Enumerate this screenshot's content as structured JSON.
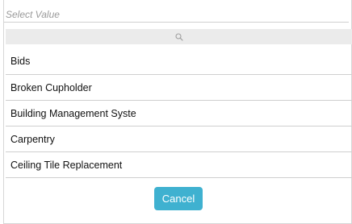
{
  "select": {
    "placeholder": "Select Value"
  },
  "search": {
    "icon": "search-icon"
  },
  "options": [
    {
      "label": "Bids"
    },
    {
      "label": "Broken Cupholder"
    },
    {
      "label": "Building Management Syste"
    },
    {
      "label": "Carpentry"
    },
    {
      "label": "Ceiling Tile Replacement"
    }
  ],
  "actions": {
    "cancel_label": "Cancel"
  },
  "colors": {
    "accent": "#3fb1d0",
    "search_bar_bg": "#ebebeb",
    "divider": "#cfcfcf"
  }
}
